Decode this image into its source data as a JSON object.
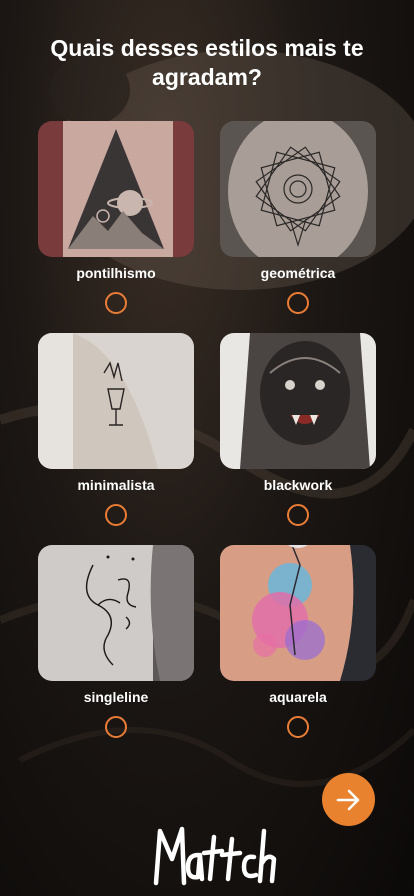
{
  "page": {
    "title": "Quais desses estilos mais te agradam?"
  },
  "styles": [
    {
      "label": "pontilhismo",
      "selected": false
    },
    {
      "label": "geométrica",
      "selected": false
    },
    {
      "label": "minimalista",
      "selected": false
    },
    {
      "label": "blackwork",
      "selected": false
    },
    {
      "label": "singleline",
      "selected": false
    },
    {
      "label": "aquarela",
      "selected": false
    }
  ],
  "next_button": {
    "icon": "arrow-right-icon"
  },
  "brand": {
    "logo_text": "Mattch"
  },
  "colors": {
    "accent": "#e8822f",
    "text": "#ffffff"
  }
}
